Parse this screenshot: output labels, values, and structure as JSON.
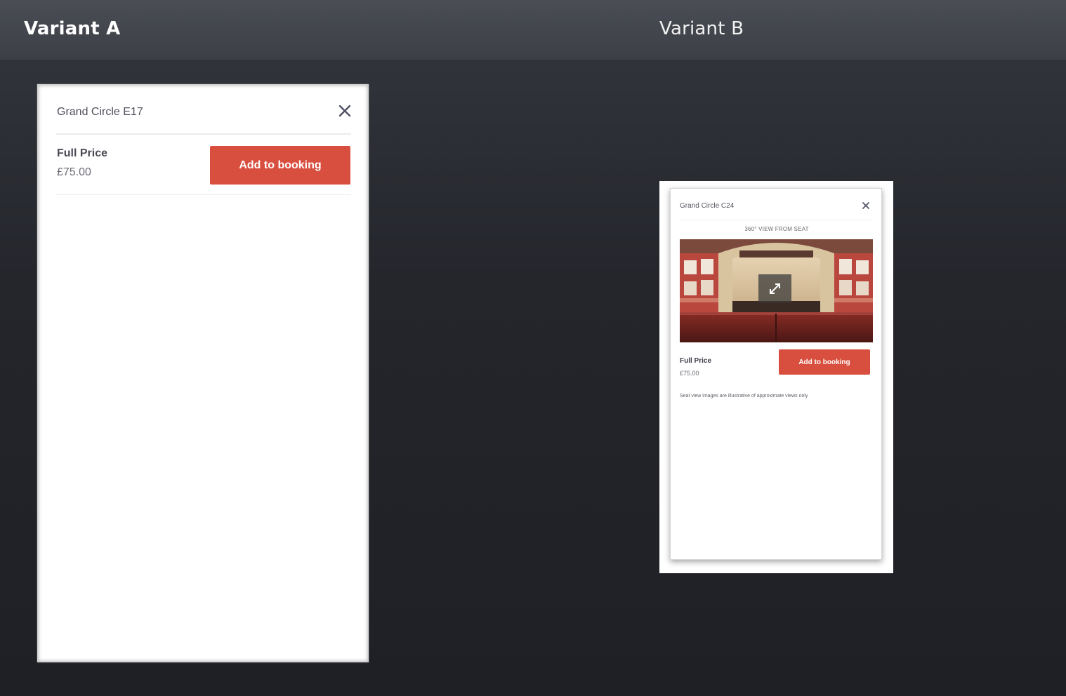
{
  "header": {
    "variant_a_label": "Variant A",
    "variant_b_label": "Variant B"
  },
  "variant_a": {
    "seat_title": "Grand Circle E17",
    "close_icon": "close-icon",
    "ticket_type": "Full Price",
    "price": "£75.00",
    "add_button_label": "Add to booking",
    "accent_color": "#d94f3f"
  },
  "variant_b": {
    "seat_title": "Grand Circle C24",
    "close_icon": "close-icon",
    "view_label": "360° VIEW FROM SEAT",
    "seat_view_image": "theatre-view-image",
    "expand_icon": "expand-icon",
    "ticket_type": "Full Price",
    "price": "£75.00",
    "add_button_label": "Add to booking",
    "disclaimer": "Seat view images are illustrative of approximate views only",
    "accent_color": "#d94f3f"
  }
}
